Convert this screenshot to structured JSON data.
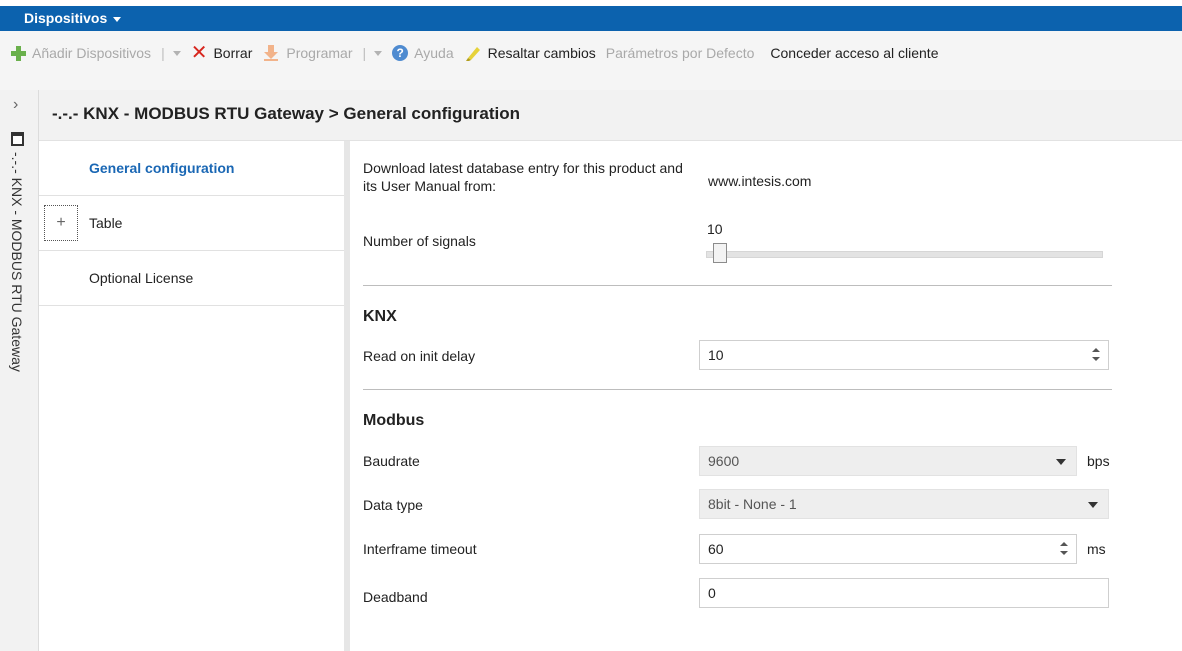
{
  "menu": {
    "title": "Dispositivos"
  },
  "toolbar": {
    "add": "Añadir Dispositivos",
    "delete": "Borrar",
    "program": "Programar",
    "help": "Ayuda",
    "highlight": "Resaltar cambios",
    "defaults": "Parámetros por Defecto",
    "grant_access": "Conceder acceso al cliente"
  },
  "sidebar": {
    "device_label": "-.-.- KNX - MODBUS RTU Gateway"
  },
  "header": {
    "title": "-.-.- KNX - MODBUS RTU Gateway > General configuration"
  },
  "nav": {
    "items": [
      {
        "label": "General configuration",
        "active": true
      },
      {
        "label": "Table",
        "expandable": true
      },
      {
        "label": "Optional License"
      }
    ]
  },
  "general": {
    "download_label": "Download latest database entry for this product and its User Manual from:",
    "download_link": "www.intesis.com",
    "signals_label": "Number of signals",
    "signals_value": "10",
    "signals_slider_min": 10,
    "signals_slider_max": 600
  },
  "knx": {
    "section": "KNX",
    "read_delay_label": "Read on init delay",
    "read_delay_value": "10"
  },
  "modbus": {
    "section": "Modbus",
    "baudrate_label": "Baudrate",
    "baudrate_value": "9600",
    "baudrate_unit": "bps",
    "datatype_label": "Data type",
    "datatype_value": "8bit - None - 1",
    "timeout_label": "Interframe timeout",
    "timeout_value": "60",
    "timeout_unit": "ms",
    "deadband_label": "Deadband",
    "deadband_value": "0"
  }
}
